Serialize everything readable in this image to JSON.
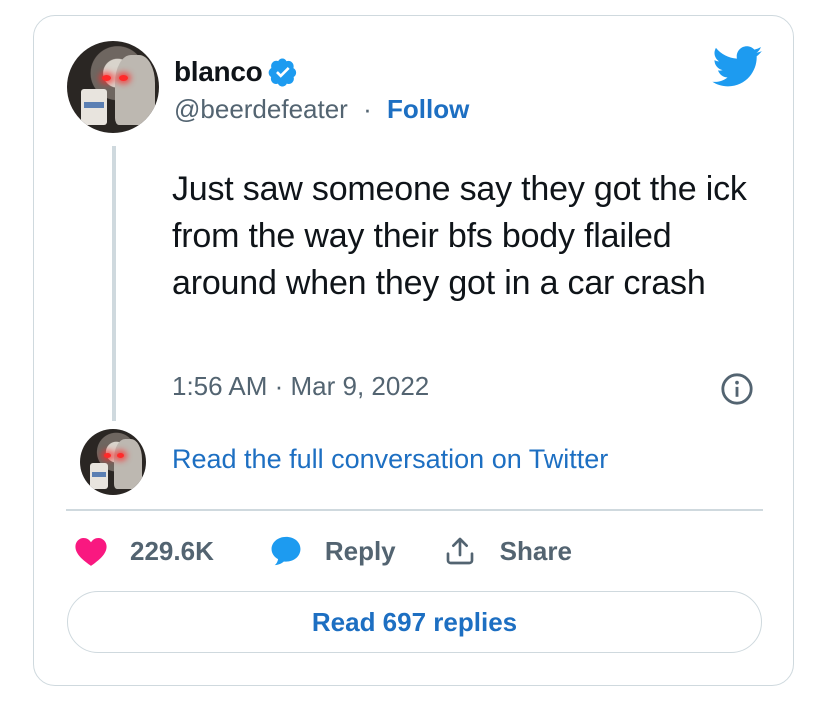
{
  "author": {
    "name": "blanco",
    "handle": "@beerdefeater",
    "separator": "·",
    "follow_label": "Follow",
    "verified": true
  },
  "tweet": {
    "text": "Just saw someone say they got the ick from the way their bfs body flailed around when they got in a car crash",
    "timestamp": "1:56 AM · Mar 9, 2022"
  },
  "conversation_link": "Read the full conversation on Twitter",
  "actions": {
    "likes": "229.6K",
    "reply_label": "Reply",
    "share_label": "Share"
  },
  "read_replies_label": "Read 697 replies",
  "colors": {
    "link": "#1d6fc2",
    "verified": "#1d9bf0",
    "heart": "#f91880",
    "border": "#cfd9de",
    "muted": "#536471"
  },
  "icons": [
    "verified-badge-icon",
    "twitter-bird-icon",
    "info-icon",
    "heart-icon",
    "reply-bubble-icon",
    "share-icon"
  ]
}
